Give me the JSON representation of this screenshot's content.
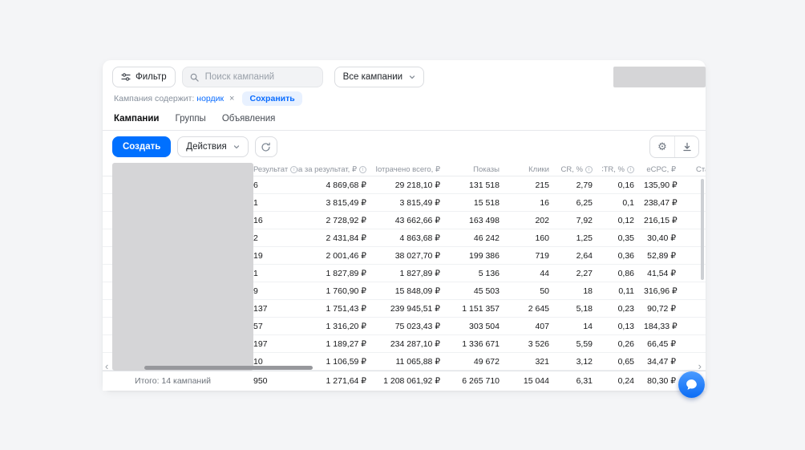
{
  "colors": {
    "accent": "#0070ff",
    "page_bg": "#f4f5f7",
    "card_bg": "#ffffff",
    "redaction": "#d5d5d7",
    "link_blue": "#0a6cff"
  },
  "toolbar": {
    "filter_label": "Фильтр",
    "filter_icon": "sliders-icon",
    "search_placeholder": "Поиск кампаний",
    "search_icon": "search-icon",
    "scope_label": "Все кампании",
    "scope_icon": "chevron-down-icon"
  },
  "filter_chip": {
    "prefix": "Кампания содержит:",
    "value": "нордик",
    "remove_icon": "×",
    "save_label": "Сохранить"
  },
  "tabs": [
    {
      "id": "campaigns",
      "label": "Кампании",
      "active": true
    },
    {
      "id": "groups",
      "label": "Группы",
      "active": false
    },
    {
      "id": "ads",
      "label": "Объявления",
      "active": false
    }
  ],
  "actionbar": {
    "create_label": "Создать",
    "actions_label": "Действия",
    "refresh_icon": "refresh-icon",
    "settings_icon": "gear-icon",
    "export_icon": "download-icon"
  },
  "table": {
    "columns": [
      {
        "key": "name",
        "label": "",
        "align": "left"
      },
      {
        "key": "result",
        "label": "Результат",
        "align": "left",
        "info": true
      },
      {
        "key": "cost_per_result",
        "label": "Цена за результат, ₽",
        "align": "right",
        "info": true
      },
      {
        "key": "spent_total",
        "label": "Потрачено всего, ₽",
        "align": "right"
      },
      {
        "key": "impressions",
        "label": "Показы",
        "align": "right"
      },
      {
        "key": "clicks",
        "label": "Клики",
        "align": "right"
      },
      {
        "key": "cr",
        "label": "CR, %",
        "align": "right",
        "info": true
      },
      {
        "key": "ctr",
        "label": "CTR, %",
        "align": "right",
        "info": true
      },
      {
        "key": "ecpc",
        "label": "eCPC, ₽",
        "align": "right"
      },
      {
        "key": "start",
        "label": "Старт пр",
        "align": "left"
      }
    ],
    "rows": [
      [
        "",
        "6",
        "4 869,68 ₽",
        "29 218,10 ₽",
        "131 518",
        "215",
        "2,79",
        "0,16",
        "135,90 ₽",
        ""
      ],
      [
        "",
        "1",
        "3 815,49 ₽",
        "3 815,49 ₽",
        "15 518",
        "16",
        "6,25",
        "0,1",
        "238,47 ₽",
        ""
      ],
      [
        "",
        "16",
        "2 728,92 ₽",
        "43 662,66 ₽",
        "163 498",
        "202",
        "7,92",
        "0,12",
        "216,15 ₽",
        ""
      ],
      [
        "",
        "2",
        "2 431,84 ₽",
        "4 863,68 ₽",
        "46 242",
        "160",
        "1,25",
        "0,35",
        "30,40 ₽",
        ""
      ],
      [
        "",
        "19",
        "2 001,46 ₽",
        "38 027,70 ₽",
        "199 386",
        "719",
        "2,64",
        "0,36",
        "52,89 ₽",
        ""
      ],
      [
        "",
        "1",
        "1 827,89 ₽",
        "1 827,89 ₽",
        "5 136",
        "44",
        "2,27",
        "0,86",
        "41,54 ₽",
        ""
      ],
      [
        "",
        "9",
        "1 760,90 ₽",
        "15 848,09 ₽",
        "45 503",
        "50",
        "18",
        "0,11",
        "316,96 ₽",
        ""
      ],
      [
        "",
        "137",
        "1 751,43 ₽",
        "239 945,51 ₽",
        "1 151 357",
        "2 645",
        "5,18",
        "0,23",
        "90,72 ₽",
        ""
      ],
      [
        "",
        "57",
        "1 316,20 ₽",
        "75 023,43 ₽",
        "303 504",
        "407",
        "14",
        "0,13",
        "184,33 ₽",
        ""
      ],
      [
        "",
        "197",
        "1 189,27 ₽",
        "234 287,10 ₽",
        "1 336 671",
        "3 526",
        "5,59",
        "0,26",
        "66,45 ₽",
        ""
      ],
      [
        "",
        "10",
        "1 106,59 ₽",
        "11 065,88 ₽",
        "49 672",
        "321",
        "3,12",
        "0,65",
        "34,47 ₽",
        ""
      ]
    ],
    "footer": [
      "Итого: 14 кампаний",
      "950",
      "1 271,64 ₽",
      "1 208 061,92 ₽",
      "6 265 710",
      "15 044",
      "6,31",
      "0,24",
      "80,30 ₽",
      ""
    ]
  },
  "chat": {
    "icon": "chat-bubble-icon"
  }
}
